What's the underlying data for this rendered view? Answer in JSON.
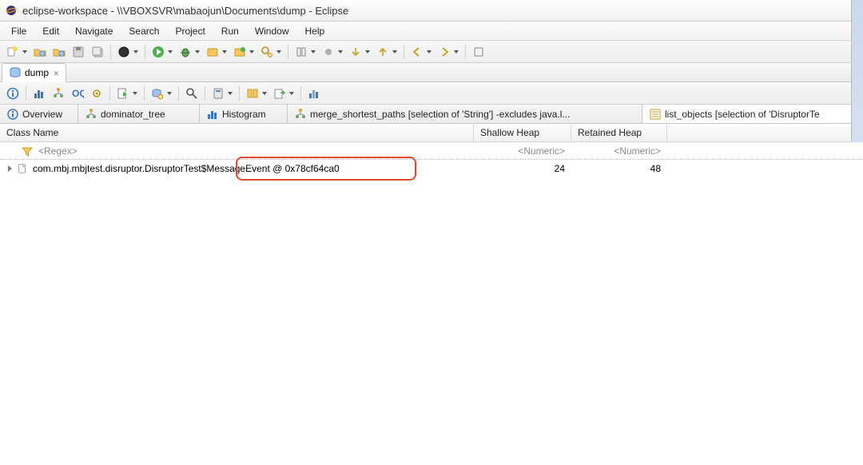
{
  "window": {
    "title": "eclipse-workspace - \\\\VBOXSVR\\mabaojun\\Documents\\dump - Eclipse"
  },
  "menu": {
    "items": [
      "File",
      "Edit",
      "Navigate",
      "Search",
      "Project",
      "Run",
      "Window",
      "Help"
    ]
  },
  "editor_tab": {
    "label": "dump"
  },
  "sub_tabs": {
    "items": [
      {
        "label": "Overview",
        "icon": "info"
      },
      {
        "label": "dominator_tree",
        "icon": "tree"
      },
      {
        "label": "Histogram",
        "icon": "histogram"
      },
      {
        "label": "merge_shortest_paths [selection of 'String'] -excludes java.l...",
        "icon": "tree"
      },
      {
        "label": "list_objects [selection of 'DisruptorTe",
        "icon": "list"
      }
    ],
    "active_index": 4
  },
  "columns": {
    "class_name": "Class Name",
    "shallow": "Shallow Heap",
    "retained": "Retained Heap"
  },
  "regex_row": {
    "placeholder": "<Regex>",
    "numeric": "<Numeric>"
  },
  "data_row": {
    "class_name": "com.mbj.mbjtest.disruptor.DisruptorTest$MessageEvent @ 0x78cf64ca0",
    "shallow": "24",
    "retained": "48"
  }
}
